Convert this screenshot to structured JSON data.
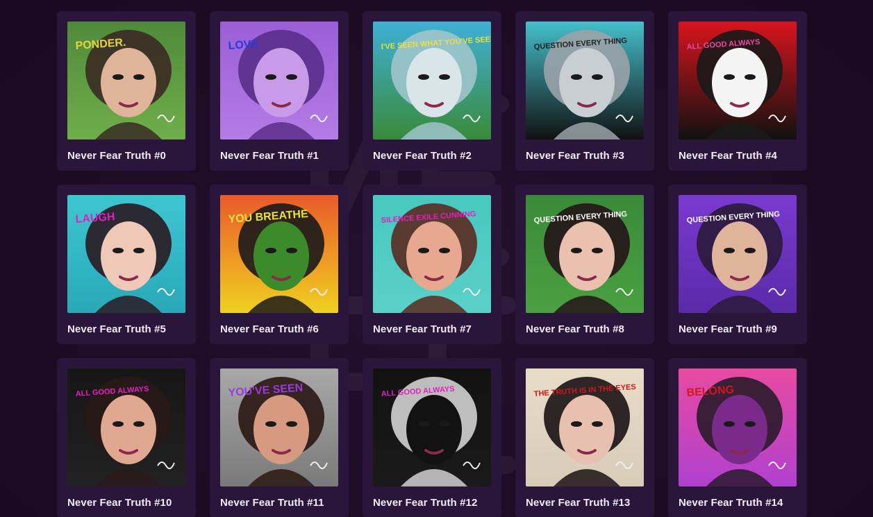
{
  "gallery": {
    "items": [
      {
        "title": "Never Fear Truth #0",
        "art": {
          "bg": "#4f8a3a",
          "bg2": "#6fae4a",
          "subject": "#e0b49a",
          "hair": "#3a2a24",
          "scribble": "PONDER.",
          "scribble_color": "#e3d53c"
        }
      },
      {
        "title": "Never Fear Truth #1",
        "art": {
          "bg": "#9a5ed6",
          "bg2": "#b47ce6",
          "subject": "#c89ae8",
          "hair": "#5a2e8a",
          "scribble": "LOVE",
          "scribble_color": "#2a3bd8"
        }
      },
      {
        "title": "Never Fear Truth #2",
        "art": {
          "bg": "#3fb0d6",
          "bg2": "#3a8a3a",
          "subject": "#d8e6ea",
          "hair": "#9fc4cc",
          "scribble": "I'VE SEEN WHAT YOU'VE SEEN",
          "scribble_color": "#e8e040"
        }
      },
      {
        "title": "Never Fear Truth #3",
        "art": {
          "bg": "#44c0cc",
          "bg2": "#111111",
          "subject": "#c7cfd2",
          "hair": "#9aa3a8",
          "scribble": "QUESTION EVERY THING",
          "scribble_color": "#222222"
        }
      },
      {
        "title": "Never Fear Truth #4",
        "art": {
          "bg": "#d8141c",
          "bg2": "#111111",
          "subject": "#f4f4f4",
          "hair": "#1a1a1a",
          "scribble": "ALL GOOD ALWAYS",
          "scribble_color": "#e84aa0"
        }
      },
      {
        "title": "Never Fear Truth #5",
        "art": {
          "bg": "#3cc6d0",
          "bg2": "#2aa8b8",
          "subject": "#f0c8b8",
          "hair": "#2a1a22",
          "scribble": "LAUGH",
          "scribble_color": "#e020c0"
        }
      },
      {
        "title": "Never Fear Truth #6",
        "art": {
          "bg": "#ea5a2a",
          "bg2": "#f0d020",
          "subject": "#3c8a2a",
          "hair": "#1a1a1a",
          "scribble": "YOU BREATHE",
          "scribble_color": "#e8e040"
        }
      },
      {
        "title": "Never Fear Truth #7",
        "art": {
          "bg": "#48c8c0",
          "bg2": "#5ad0c8",
          "subject": "#e8a890",
          "hair": "#5a2a20",
          "scribble": "SILENCE EXILE CUNNING",
          "scribble_color": "#e020c0"
        }
      },
      {
        "title": "Never Fear Truth #8",
        "art": {
          "bg": "#3a8a3a",
          "bg2": "#4aa040",
          "subject": "#eac0ae",
          "hair": "#241418",
          "scribble": "QUESTION EVERY THING",
          "scribble_color": "#ffffff"
        }
      },
      {
        "title": "Never Fear Truth #9",
        "art": {
          "bg": "#7a3ad0",
          "bg2": "#5a2aa8",
          "subject": "#e0b49a",
          "hair": "#2a1a3a",
          "scribble": "QUESTION EVERY THING",
          "scribble_color": "#ffffff"
        }
      },
      {
        "title": "Never Fear Truth #10",
        "art": {
          "bg": "#161616",
          "bg2": "#222222",
          "subject": "#e0a890",
          "hair": "#2a1a1a",
          "scribble": "ALL GOOD ALWAYS",
          "scribble_color": "#e020c0"
        }
      },
      {
        "title": "Never Fear Truth #11",
        "art": {
          "bg": "#a8a8a8",
          "bg2": "#7a7a7a",
          "subject": "#d69a80",
          "hair": "#2a1612",
          "scribble": "YOU'VE SEEN",
          "scribble_color": "#9a3ae0"
        }
      },
      {
        "title": "Never Fear Truth #12",
        "art": {
          "bg": "#121212",
          "bg2": "#1a1a1a",
          "subject": "#121212",
          "hair": "#d0d0d0",
          "scribble": "ALL GOOD ALWAYS",
          "scribble_color": "#e020c0"
        }
      },
      {
        "title": "Never Fear Truth #13",
        "art": {
          "bg": "#e8dcc8",
          "bg2": "#d8ccb8",
          "subject": "#e8c0b0",
          "hair": "#1a1214",
          "scribble": "THE TRUTH IS IN THE EYES",
          "scribble_color": "#d0181c"
        }
      },
      {
        "title": "Never Fear Truth #14",
        "art": {
          "bg": "#e84aa0",
          "bg2": "#b040d0",
          "subject": "#7a2a8a",
          "hair": "#2a1a2a",
          "scribble": "BELONG",
          "scribble_color": "#d0181c"
        }
      }
    ]
  }
}
